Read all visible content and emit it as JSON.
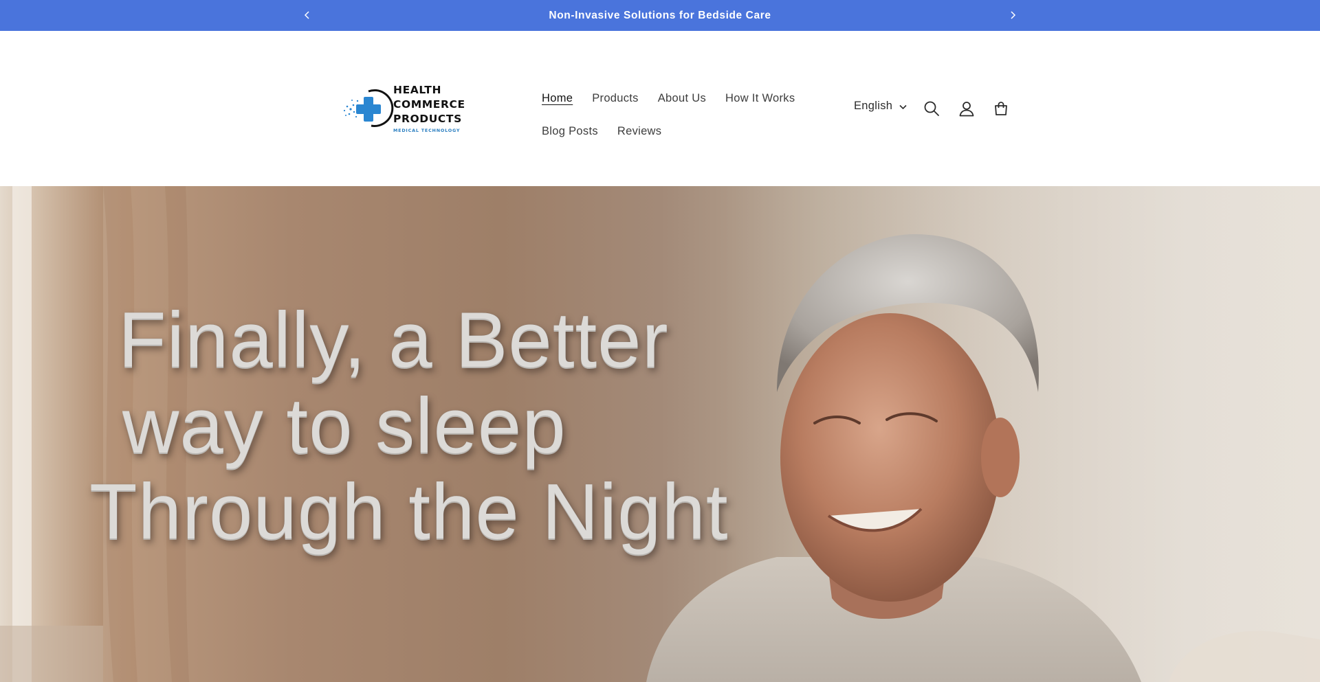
{
  "announcement": {
    "text": "Non-Invasive Solutions for Bedside Care",
    "prev_icon": "chevron-left-icon",
    "next_icon": "chevron-right-icon"
  },
  "logo": {
    "line1": "HEALTH",
    "line2": "COMMERCE",
    "line3": "PRODUCTS",
    "tagline": "MEDICAL TECHNOLOGY",
    "colors": {
      "cross": "#2a86d1",
      "text": "#111111"
    }
  },
  "nav": {
    "items": [
      {
        "label": "Home",
        "active": true
      },
      {
        "label": "Products"
      },
      {
        "label": "About Us"
      },
      {
        "label": "How It Works"
      },
      {
        "label": "Blog Posts"
      },
      {
        "label": "Reviews"
      }
    ]
  },
  "header_actions": {
    "language": "English",
    "icons": [
      "search-icon",
      "account-icon",
      "cart-icon"
    ]
  },
  "hero": {
    "headline_lines": [
      "Finally, a Better",
      "way to sleep",
      "Through the Night"
    ]
  },
  "colors": {
    "announcement_bg": "#4a74dc",
    "announcement_text": "#ffffff",
    "nav_text": "#3d3d3d",
    "headline_text": "#dcdad7"
  }
}
